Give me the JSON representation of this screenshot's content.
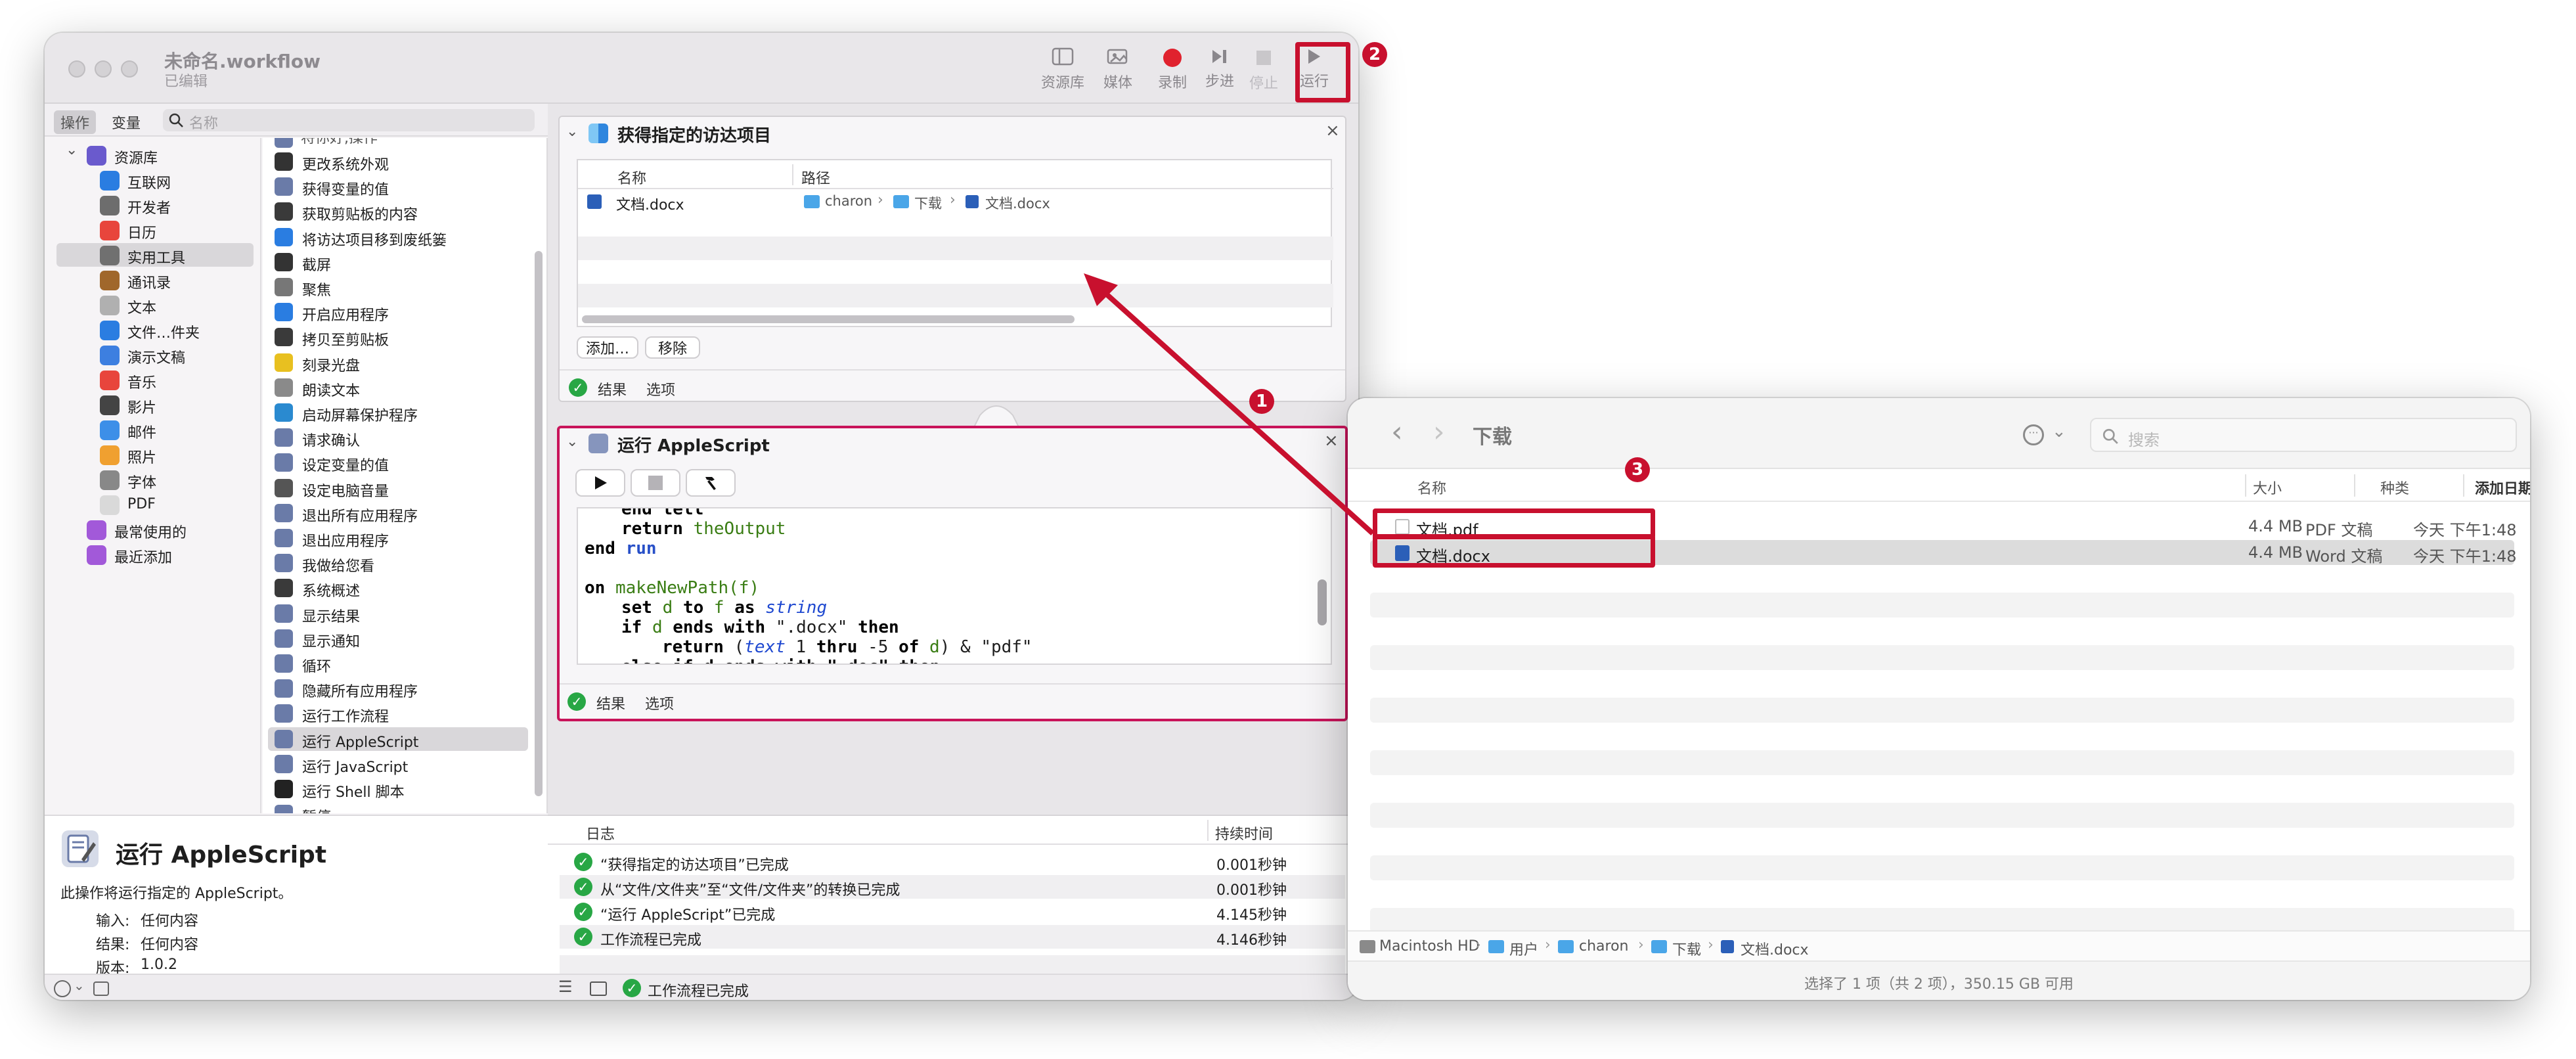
{
  "automator": {
    "title": "未命名.workflow",
    "subtitle": "已编辑",
    "toolbar": [
      {
        "label": "资源库",
        "icon": "library-icon"
      },
      {
        "label": "媒体",
        "icon": "media-icon"
      },
      {
        "label": "录制",
        "icon": "record-icon"
      },
      {
        "label": "步进",
        "icon": "step-icon"
      },
      {
        "label": "停止",
        "icon": "stop-icon"
      },
      {
        "label": "运行",
        "icon": "play-icon"
      }
    ],
    "search_tabs": [
      "操作",
      "变量"
    ],
    "search_placeholder": "名称",
    "library_items": [
      "资源库",
      "互联网",
      "开发者",
      "日历",
      "实用工具",
      "通讯录",
      "文本",
      "文件…件夹",
      "演示文稿",
      "音乐",
      "影片",
      "邮件",
      "照片",
      "字体",
      "PDF",
      "最常使用的",
      "最近添加"
    ],
    "library_colors": [
      "#6a5acd",
      "#2a7de1",
      "#6d6d6d",
      "#e8453c",
      "#707070",
      "#a0672b",
      "#b0b0b0",
      "#2a7de1",
      "#3d7fe0",
      "#e8453c",
      "#444444",
      "#3d8fe8",
      "#f0a030",
      "#888888",
      "#d9d9d9",
      "#a259d9",
      "#a259d9"
    ],
    "actions": [
      "更改系统外观",
      "获得变量的值",
      "获取剪贴板的内容",
      "将访达项目移到废纸篓",
      "截屏",
      "聚焦",
      "开启应用程序",
      "拷贝至剪贴板",
      "刻录光盘",
      "朗读文本",
      "启动屏幕保护程序",
      "请求确认",
      "设定变量的值",
      "设定电脑音量",
      "退出所有应用程序",
      "退出应用程序",
      "我做给您看",
      "系统概述",
      "显示结果",
      "显示通知",
      "循环",
      "隐藏所有应用程序",
      "运行工作流程",
      "运行 AppleScript",
      "运行 JavaScript",
      "运行 Shell 脚本",
      "暂停"
    ],
    "action_colors": [
      "#333333",
      "#6a7ba8",
      "#3a3a3a",
      "#2a7de1",
      "#333333",
      "#777777",
      "#2a7de1",
      "#3a3a3a",
      "#e8c020",
      "#8a8a8a",
      "#2a8ad0",
      "#6a7ba8",
      "#6a7ba8",
      "#555555",
      "#6a7ba8",
      "#6a7ba8",
      "#6a7ba8",
      "#3a3a3a",
      "#6a7ba8",
      "#6a7ba8",
      "#6a7ba8",
      "#6a7ba8",
      "#6a7ba8",
      "#6a7ba8",
      "#6a7ba8",
      "#222222",
      "#6a7ba8"
    ],
    "action_partial_top": "将你好,操作",
    "selected_action_index": 23,
    "description": {
      "title": "运行 AppleScript",
      "text": "此操作将运行指定的 AppleScript。",
      "input_label": "输入:",
      "input_value": "任何内容",
      "result_label": "结果:",
      "result_value": "任何内容",
      "version_label": "版本:",
      "version_value": "1.0.2"
    },
    "block1": {
      "title": "获得指定的访达项目",
      "col_name": "名称",
      "col_path": "路径",
      "row_name": "文档.docx",
      "path": [
        "charon",
        "下载",
        "文档.docx"
      ],
      "add_button": "添加…",
      "remove_button": "移除",
      "footer_results": "结果",
      "footer_options": "选项"
    },
    "block2": {
      "title": "运行 AppleScript",
      "footer_results": "结果",
      "footer_options": "选项",
      "code": {
        "l0": "end tell",
        "l1_kw": "return",
        "l1_var": "theOutput",
        "l2_a": "end",
        "l2_b": "run",
        "l3_a": "on",
        "l3_fn": "makeNewPath",
        "l3_arg": "(f)",
        "l4_set": "set",
        "l4_d": "d",
        "l4_to": "to",
        "l4_f": "f",
        "l4_as": "as",
        "l4_string": "string",
        "l5_if": "if",
        "l5_d": "d",
        "l5_ends": "ends with",
        "l5_str": "\".docx\"",
        "l5_then": "then",
        "l6_return": "return",
        "l6_open": "(",
        "l6_text": "text",
        "l6_mid": "1",
        "l6_thru": "thru",
        "l6_n": "-5",
        "l6_of": "of",
        "l6_d": "d",
        "l6_tail": ") & \"pdf\"",
        "l7": "else if d ends with \".doc\" then"
      }
    },
    "log": {
      "col_log": "日志",
      "col_duration": "持续时间",
      "rows": [
        {
          "text": "“获得指定的访达项目”已完成",
          "duration": "0.001秒钟"
        },
        {
          "text": "从“文件/文件夹”至“文件/文件夹”的转换已完成",
          "duration": "0.001秒钟"
        },
        {
          "text": "“运行 AppleScript”已完成",
          "duration": "4.145秒钟"
        },
        {
          "text": "工作流程已完成",
          "duration": "4.146秒钟"
        }
      ]
    },
    "status": "工作流程已完成"
  },
  "finder": {
    "title": "下载",
    "search_placeholder": "搜索",
    "columns": [
      "名称",
      "大小",
      "种类",
      "添加日期"
    ],
    "files": [
      {
        "name": "文档.pdf",
        "size": "4.4 MB",
        "kind": "PDF 文稿",
        "date": "今天 下午1:48"
      },
      {
        "name": "文档.docx",
        "size": "4.4 MB",
        "kind": "Word 文稿",
        "date": "今天 下午1:48"
      }
    ],
    "pathbar": [
      "Macintosh HD",
      "用户",
      "charon",
      "下载",
      "文档.docx"
    ],
    "status": "选择了 1 项（共 2 项），350.15 GB 可用"
  },
  "annotations": [
    "1",
    "2",
    "3"
  ],
  "colors": {
    "annotation_red": "#c8102e",
    "selection_gray": "#dcdbdc",
    "block_border": "#c8145a"
  }
}
